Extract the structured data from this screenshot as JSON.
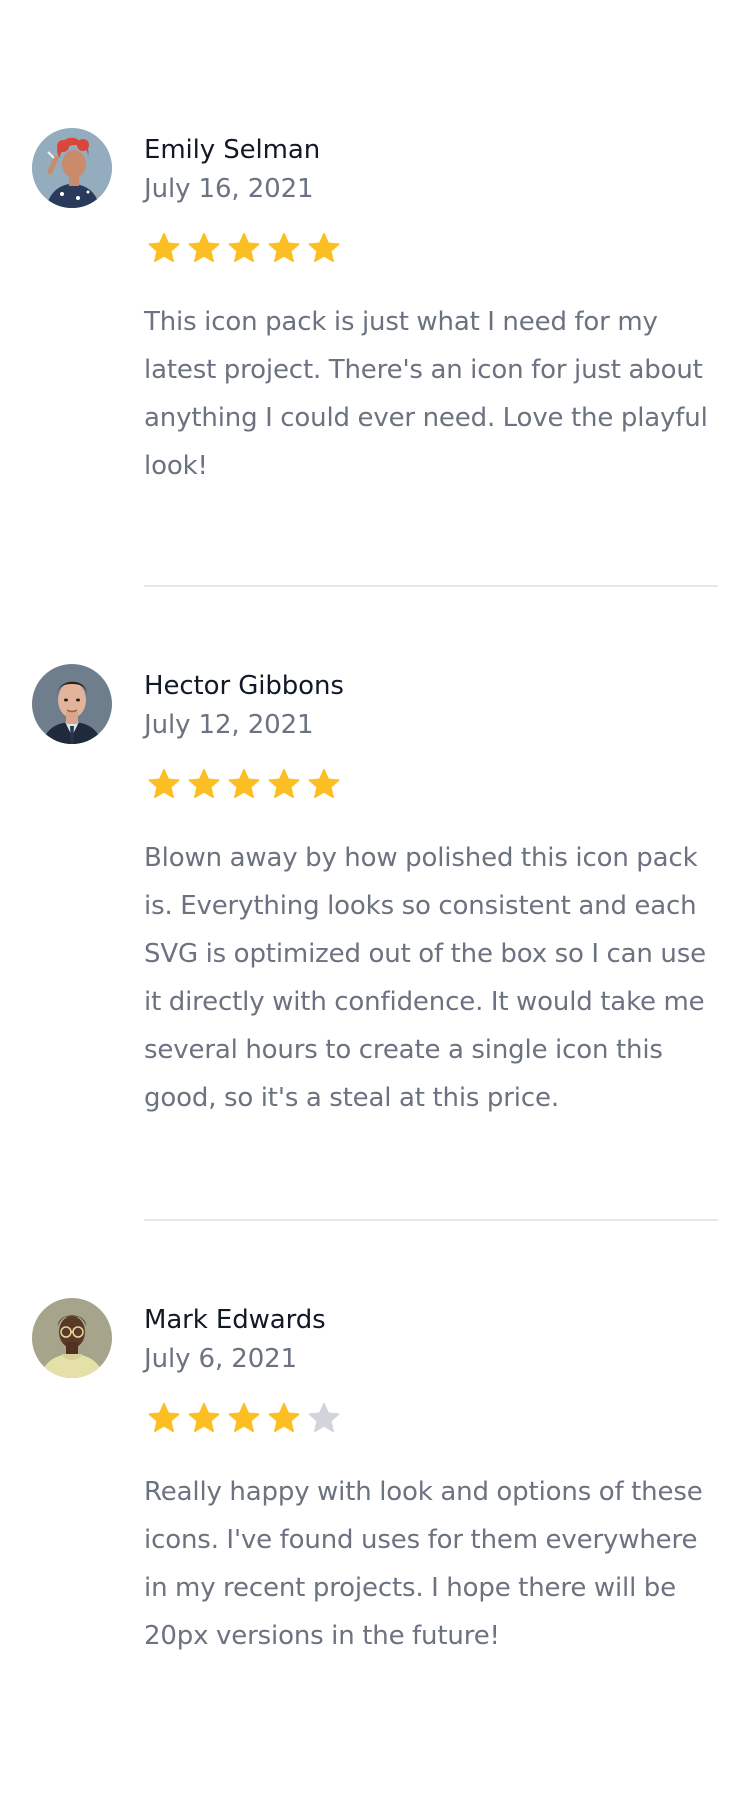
{
  "reviews": [
    {
      "author": "Emily Selman",
      "date": "July 16, 2021",
      "rating": 5,
      "text": "This icon pack is just what I need for my latest project. There's an icon for just about anything I could ever need. Love the playful look!",
      "avatar_palette": {
        "bg": "#8aa5b8",
        "skin": "#c98b6a",
        "hair": "#d9473a",
        "shirt": "#2a3a5a"
      }
    },
    {
      "author": "Hector Gibbons",
      "date": "July 12, 2021",
      "rating": 5,
      "text": "Blown away by how polished this icon pack is. Everything looks so consistent and each SVG is optimized out of the box so I can use it directly with confidence. It would take me several hours to create a single icon this good, so it's a steal at this price.",
      "avatar_palette": {
        "bg": "#6e7e8c",
        "skin": "#e2b49b",
        "hair": "#2d1f1a",
        "shirt": "#1f2a3c"
      }
    },
    {
      "author": "Mark Edwards",
      "date": "July 6, 2021",
      "rating": 4,
      "text": "Really happy with look and options of these icons. I've found uses for them everywhere in my recent projects. I hope there will be 20px versions in the future!",
      "avatar_palette": {
        "bg": "#9a9a80",
        "skin": "#5a3a26",
        "hair": "#231710",
        "shirt": "#e5e0a8"
      }
    }
  ],
  "max_rating": 5,
  "colors": {
    "star_filled": "#fbbf24",
    "star_empty": "#d1d5db",
    "name": "#111827",
    "muted": "#6b7280",
    "divider": "#e5e7eb"
  }
}
